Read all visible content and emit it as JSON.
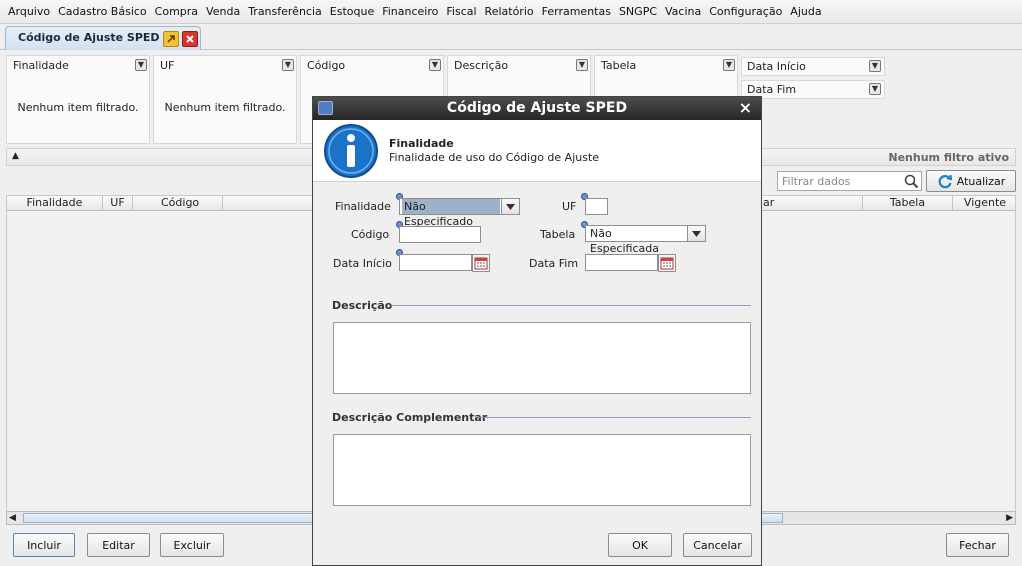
{
  "menu": [
    "Arquivo",
    "Cadastro Básico",
    "Compra",
    "Venda",
    "Transferência",
    "Estoque",
    "Financeiro",
    "Fiscal",
    "Relatório",
    "Ferramentas",
    "SNGPC",
    "Vacina",
    "Configuração",
    "Ajuda"
  ],
  "tab": {
    "title": "Código de Ajuste SPED",
    "detach_icon": "detach-icon",
    "close_icon": "close-icon"
  },
  "filters": {
    "panels": [
      {
        "title": "Finalidade",
        "empty_text": "Nenhum item filtrado."
      },
      {
        "title": "UF",
        "empty_text": "Nenhum item filtrado."
      },
      {
        "title": "Código",
        "empty_text": ""
      },
      {
        "title": "Descrição",
        "empty_text": ""
      },
      {
        "title": "Tabela",
        "empty_text": ""
      }
    ],
    "date_start": "Data Início",
    "date_end": "Data Fim",
    "status": "Nenhum filtro ativo",
    "search_placeholder": "Filtrar dados",
    "refresh_label": "Atualizar"
  },
  "table": {
    "columns_left": [
      "Finalidade",
      "UF",
      "Código"
    ],
    "columns_right": [
      "ar",
      "Tabela",
      "Vigente"
    ]
  },
  "footer": {
    "include": "Incluir",
    "edit": "Editar",
    "delete": "Excluir",
    "close": "Fechar"
  },
  "dialog": {
    "title": "Código de Ajuste SPED",
    "close_glyph": "×",
    "header_title": "Finalidade",
    "header_subtitle": "Finalidade de uso do Código de Ajuste",
    "fields": {
      "finalidade_label": "Finalidade",
      "finalidade_value": "Não Especificado",
      "uf_label": "UF",
      "uf_value": "",
      "codigo_label": "Código",
      "codigo_value": "",
      "tabela_label": "Tabela",
      "tabela_value": "Não Especificada",
      "data_inicio_label": "Data Início",
      "data_inicio_value": "",
      "data_fim_label": "Data Fim",
      "data_fim_value": ""
    },
    "descricao_label": "Descrição",
    "descricao_compl_label": "Descrição Complementar",
    "ok": "OK",
    "cancel": "Cancelar"
  },
  "colors": {
    "title_bar": "#333333",
    "info_icon": "#1a73c9",
    "selected_combo": "#9fb0c9"
  }
}
